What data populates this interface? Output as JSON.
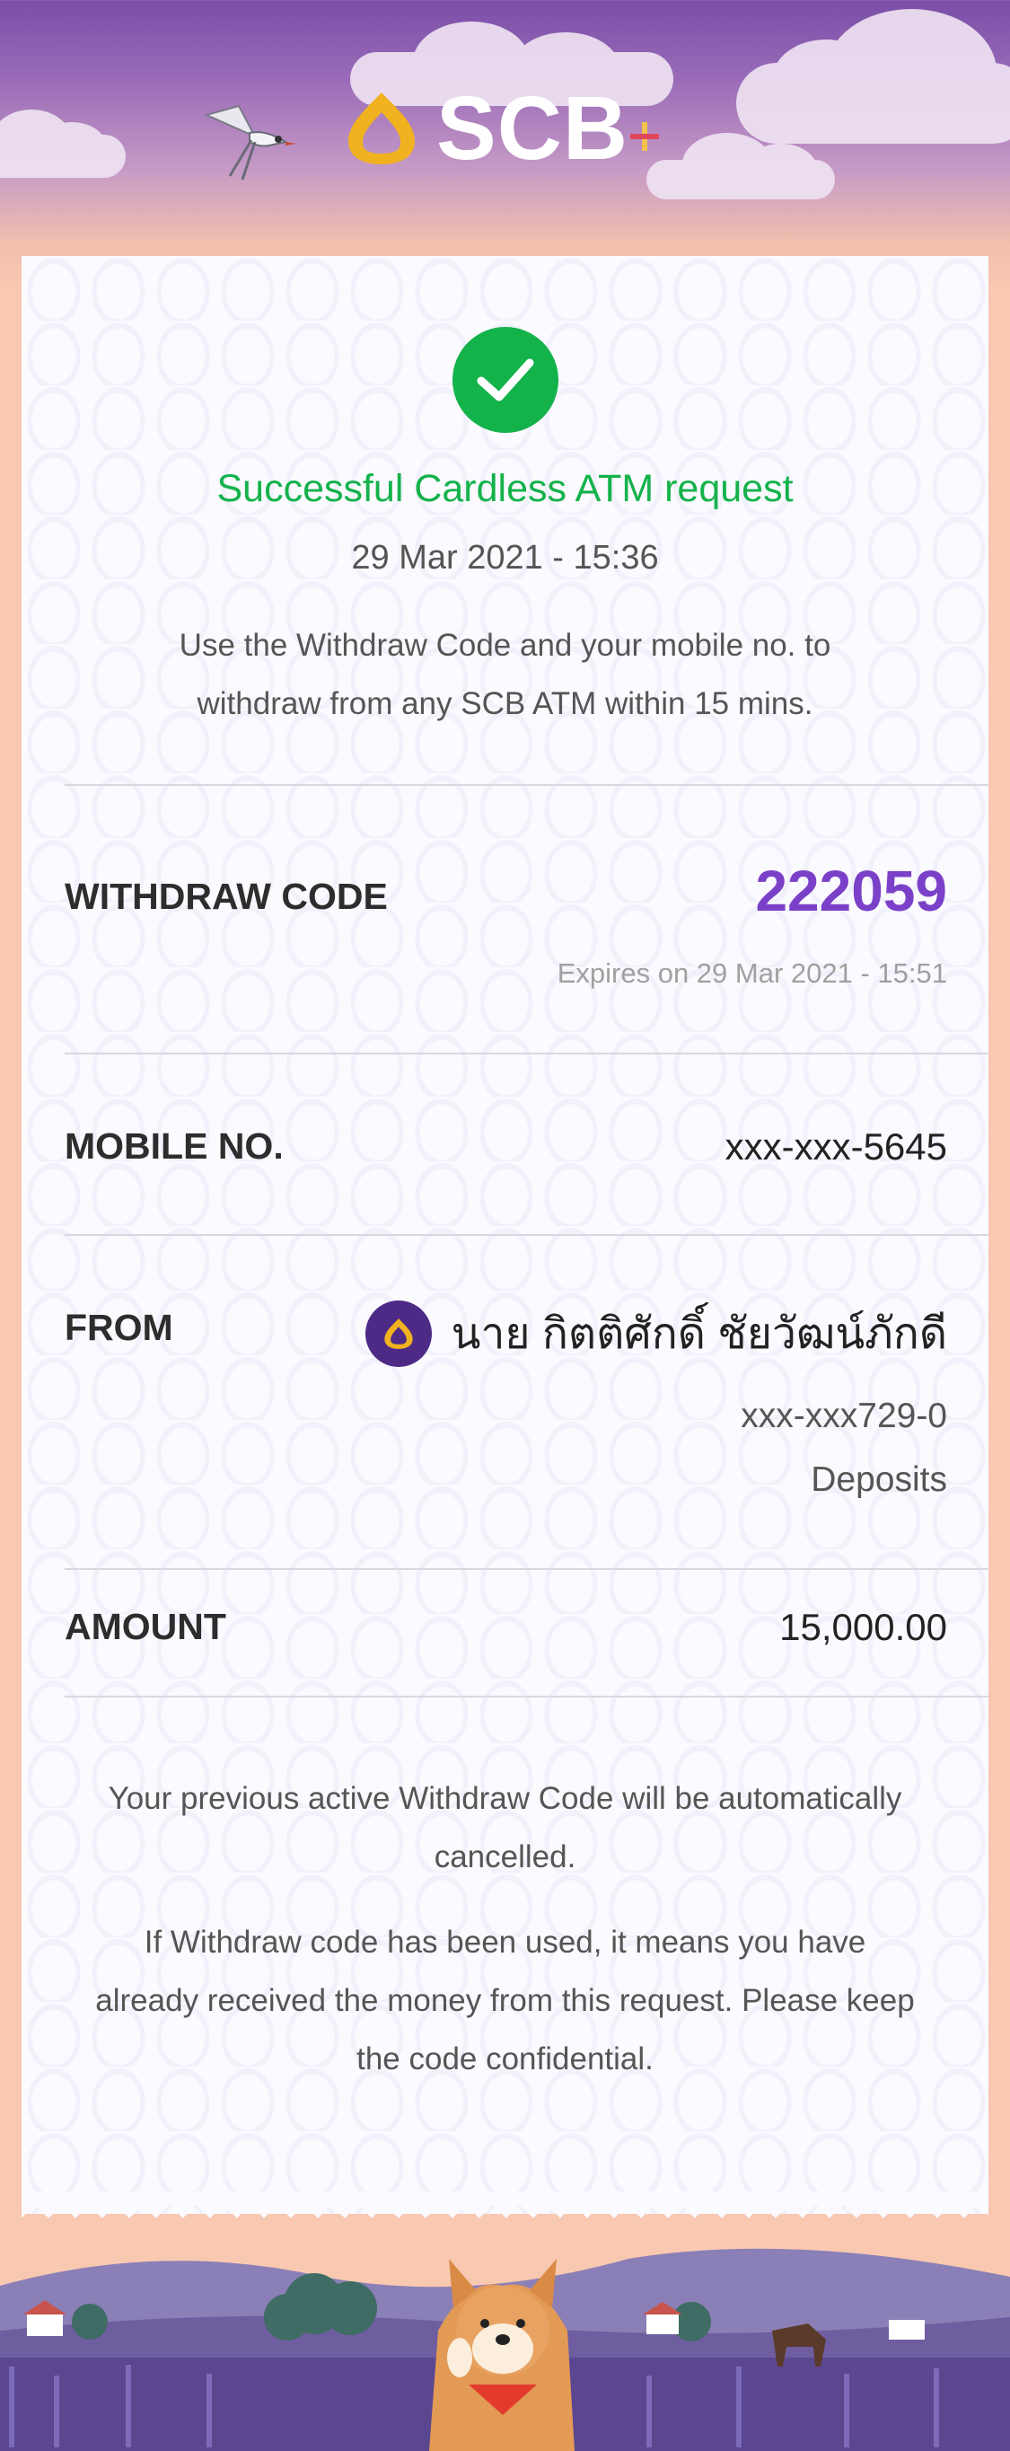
{
  "brand": {
    "name": "SCB"
  },
  "status": {
    "title": "Successful Cardless ATM request",
    "datetime": "29 Mar 2021 - 15:36",
    "description": "Use the Withdraw Code and your mobile no. to withdraw from any SCB ATM within 15 mins."
  },
  "withdraw": {
    "label": "WITHDRAW CODE",
    "code": "222059",
    "expires": "Expires on 29 Mar 2021 - 15:51"
  },
  "mobile": {
    "label": "MOBILE NO.",
    "value": "xxx-xxx-5645"
  },
  "from": {
    "label": "FROM",
    "name": "นาย กิตติศักดิ์ ชัยวัฒน์ภักดี",
    "account": "xxx-xxx729-0",
    "account_type": "Deposits"
  },
  "amount": {
    "label": "AMOUNT",
    "value": "15,000.00"
  },
  "notes": {
    "cancel_notice": "Your previous active Withdraw Code will be automatically cancelled.",
    "confidential_notice": "If Withdraw code has been used, it means you have already received the money from this request. Please keep the code confidential."
  },
  "colors": {
    "success": "#14b24b",
    "code": "#7b40c8",
    "brand_purple": "#4d2a86",
    "brand_gold": "#f0b21f"
  },
  "icons": [
    "swallow-bird-icon",
    "scb-logo-icon",
    "success-check-icon",
    "scb-account-icon"
  ]
}
